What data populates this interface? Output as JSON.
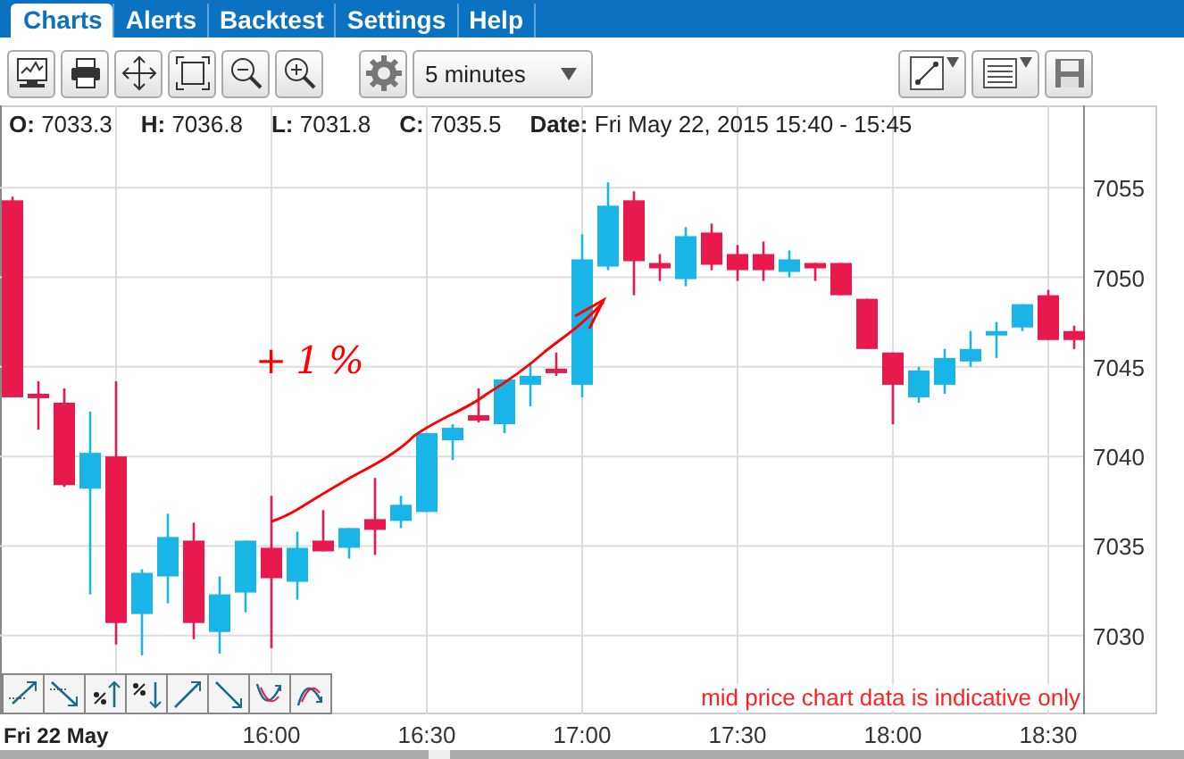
{
  "nav": {
    "tabs": [
      {
        "label": "Charts",
        "selected": true
      },
      {
        "label": "Alerts",
        "selected": false
      },
      {
        "label": "Backtest",
        "selected": false
      },
      {
        "label": "Settings",
        "selected": false
      },
      {
        "label": "Help",
        "selected": false
      }
    ]
  },
  "toolbar": {
    "interval": {
      "value": "5 minutes"
    }
  },
  "quote": {
    "items": [
      {
        "label": "O:",
        "value": "7033.3"
      },
      {
        "label": "H:",
        "value": "7036.8"
      },
      {
        "label": "L:",
        "value": "7031.8"
      },
      {
        "label": "C:",
        "value": "7035.5"
      },
      {
        "label": "Date:",
        "value": "Fri May 22, 2015 15:40 - 15:45"
      }
    ]
  },
  "chart": {
    "date_label": "Fri 22 May",
    "notice": "mid price chart data is indicative only",
    "chart_data": {
      "type": "candlestick",
      "categories": [
        null,
        null,
        null,
        null,
        null,
        null,
        null,
        null,
        null,
        null,
        "16:00",
        null,
        null,
        null,
        null,
        null,
        "16:30",
        null,
        null,
        null,
        null,
        null,
        "17:00",
        null,
        null,
        null,
        null,
        null,
        "17:30",
        null,
        null,
        null,
        null,
        null,
        "18:00",
        null,
        null,
        null,
        null,
        null,
        "18:30",
        null
      ],
      "ohlc": [
        [
          7054.3,
          7054.5,
          7043.3,
          7043.3
        ],
        [
          7043.5,
          7044.2,
          7041.5,
          7043.3
        ],
        [
          7043.0,
          7043.8,
          7038.3,
          7038.4
        ],
        [
          7038.2,
          7042.5,
          7032.3,
          7040.2
        ],
        [
          7040.0,
          7044.2,
          7029.5,
          7030.7
        ],
        [
          7031.2,
          7033.7,
          7028.9,
          7033.5
        ],
        [
          7033.3,
          7036.8,
          7031.8,
          7035.5
        ],
        [
          7035.3,
          7036.3,
          7029.8,
          7030.7
        ],
        [
          7030.2,
          7033.3,
          7029.0,
          7032.3
        ],
        [
          7032.4,
          7035.3,
          7031.3,
          7035.3
        ],
        [
          7034.9,
          7037.8,
          7029.3,
          7033.2
        ],
        [
          7033.0,
          7035.8,
          7032.0,
          7034.9
        ],
        [
          7035.3,
          7037.0,
          7034.7,
          7034.7
        ],
        [
          7034.9,
          7036.0,
          7034.3,
          7036.0
        ],
        [
          7036.5,
          7038.8,
          7034.5,
          7035.9
        ],
        [
          7036.4,
          7037.8,
          7036.0,
          7037.3
        ],
        [
          7036.9,
          7041.3,
          7036.9,
          7041.3
        ],
        [
          7040.9,
          7041.8,
          7039.8,
          7041.6
        ],
        [
          7042.3,
          7043.8,
          7041.9,
          7042.0
        ],
        [
          7041.8,
          7044.3,
          7041.3,
          7044.3
        ],
        [
          7044.0,
          7045.2,
          7042.8,
          7044.5
        ],
        [
          7044.9,
          7045.8,
          7044.5,
          7044.8
        ],
        [
          7044.0,
          7052.4,
          7043.3,
          7051.0
        ],
        [
          7050.6,
          7055.3,
          7050.4,
          7054.0
        ],
        [
          7054.3,
          7054.8,
          7049.0,
          7050.9
        ],
        [
          7050.8,
          7051.3,
          7049.8,
          7050.5
        ],
        [
          7049.9,
          7052.8,
          7049.5,
          7052.3
        ],
        [
          7052.5,
          7053.0,
          7050.4,
          7050.7
        ],
        [
          7051.3,
          7051.8,
          7049.8,
          7050.4
        ],
        [
          7051.3,
          7052.0,
          7049.8,
          7050.4
        ],
        [
          7050.3,
          7051.5,
          7050.0,
          7051.0
        ],
        [
          7050.8,
          7050.8,
          7049.8,
          7050.5
        ],
        [
          7050.8,
          7050.8,
          7049.0,
          7049.0
        ],
        [
          7048.8,
          7048.8,
          7046.0,
          7046.0
        ],
        [
          7045.8,
          7045.8,
          7041.8,
          7044.0
        ],
        [
          7043.3,
          7045.0,
          7043.0,
          7044.8
        ],
        [
          7044.0,
          7046.0,
          7043.5,
          7045.5
        ],
        [
          7045.3,
          7047.0,
          7045.0,
          7046.0
        ],
        [
          7046.8,
          7047.5,
          7045.5,
          7047.0
        ],
        [
          7047.2,
          7048.5,
          7047.0,
          7048.5
        ],
        [
          7049.0,
          7049.3,
          7046.5,
          7046.5
        ],
        [
          7047.0,
          7047.3,
          7046.0,
          7046.5
        ]
      ],
      "grid": true,
      "ylim": [
        7025.7,
        7059.6
      ],
      "yticks": [
        7030,
        7035,
        7040,
        7045,
        7050,
        7055
      ],
      "annotations": [
        {
          "text": "+1%"
        }
      ]
    }
  }
}
